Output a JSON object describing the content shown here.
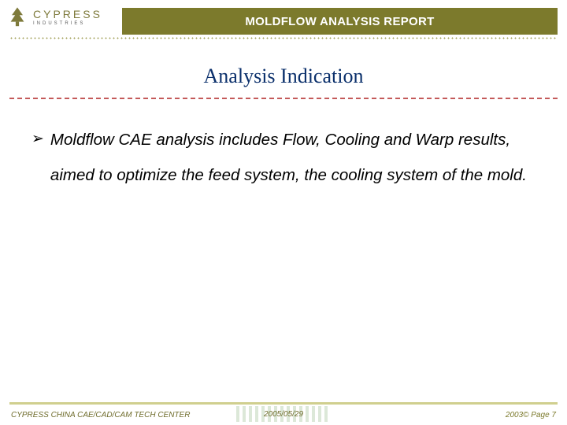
{
  "header": {
    "logo_name": "CYPRESS",
    "logo_sub": "INDUSTRIES",
    "title": "MOLDFLOW  ANALYSIS REPORT"
  },
  "section": {
    "heading": "Analysis  Indication"
  },
  "body": {
    "bullet_glyph": "➢",
    "items": [
      "Moldflow CAE analysis includes Flow, Cooling and Warp results, aimed to optimize the feed system, the cooling system  of the mold."
    ]
  },
  "footer": {
    "left": "CYPRESS CHINA CAE/CAD/CAM TECH CENTER",
    "mid": "2005/05/29",
    "right": "2003©  Page 7"
  },
  "colors": {
    "olive": "#7c7a2c",
    "navy": "#0a2f6b",
    "dash_red": "#c45a5a"
  }
}
